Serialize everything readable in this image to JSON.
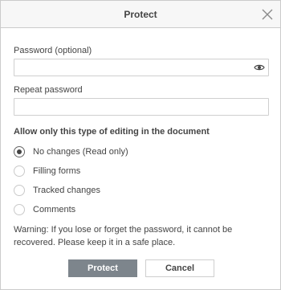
{
  "dialog": {
    "title": "Protect",
    "close_icon": "close-icon"
  },
  "password": {
    "label": "Password (optional)",
    "value": "",
    "placeholder": "",
    "toggle_icon": "eye-icon"
  },
  "repeat_password": {
    "label": "Repeat password",
    "value": "",
    "placeholder": ""
  },
  "editing": {
    "section_title": "Allow only this type of editing in the document",
    "options": [
      {
        "label": "No changes (Read only)",
        "checked": true
      },
      {
        "label": "Filling forms",
        "checked": false
      },
      {
        "label": "Tracked changes",
        "checked": false
      },
      {
        "label": "Comments",
        "checked": false
      }
    ]
  },
  "warning": "Warning: If you lose or forget the password, it cannot be recovered. Please keep it in a safe place.",
  "buttons": {
    "protect": "Protect",
    "cancel": "Cancel"
  },
  "colors": {
    "primary_button": "#7d858c",
    "border": "#cbcbcb",
    "text": "#444444"
  }
}
